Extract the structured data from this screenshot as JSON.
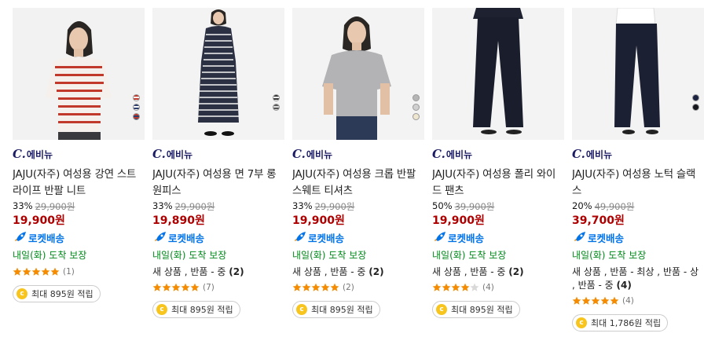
{
  "products": [
    {
      "brand": "에비뉴",
      "title": "JAJU(자주) 여성용 강연 스트라이프 반팔 니트",
      "discount": "33%",
      "original_price": "29,900원",
      "price": "19,900원",
      "rocket_label": "로켓배송",
      "delivery": "내일(화) 도착 보장",
      "condition_text": "",
      "condition_count": "",
      "rating": 5,
      "review_count": "(1)",
      "cashback": "최대 895원 적립",
      "swatches": [
        "#c0392b",
        "#2c3e6e",
        "#ffffff"
      ]
    },
    {
      "brand": "에비뉴",
      "title": "JAJU(자주) 여성용 면 7부 롱 원피스",
      "discount": "33%",
      "original_price": "29,900원",
      "price": "19,890원",
      "rocket_label": "로켓배송",
      "delivery": "내일(화) 도착 보장",
      "condition_text": "새 상품 , 반품 - 중",
      "condition_count": "(2)",
      "rating": 5,
      "review_count": "(7)",
      "cashback": "최대 895원 적립",
      "swatches": [
        "#333333",
        "#ffffff"
      ]
    },
    {
      "brand": "에비뉴",
      "title": "JAJU(자주) 여성용 크롭 반팔 스웨트 티셔츠",
      "discount": "33%",
      "original_price": "29,900원",
      "price": "19,900원",
      "rocket_label": "로켓배송",
      "delivery": "내일(화) 도착 보장",
      "condition_text": "새 상품 , 반품 - 중",
      "condition_count": "(2)",
      "rating": 5,
      "review_count": "(2)",
      "cashback": "최대 895원 적립",
      "swatches": [
        "#b5b5b5",
        "#c8c8c8",
        "#efe6cf"
      ]
    },
    {
      "brand": "에비뉴",
      "title": "JAJU(자주) 여성용 폴리 와이드 팬츠",
      "discount": "50%",
      "original_price": "39,900원",
      "price": "19,900원",
      "rocket_label": "로켓배송",
      "delivery": "내일(화) 도착 보장",
      "condition_text": "새 상품 , 반품 - 중",
      "condition_count": "(2)",
      "rating": 4,
      "review_count": "(4)",
      "cashback": "최대 895원 적립",
      "swatches": []
    },
    {
      "brand": "에비뉴",
      "title": "JAJU(자주) 여성용 노턱 슬랙스",
      "discount": "20%",
      "original_price": "49,900원",
      "price": "39,700원",
      "rocket_label": "로켓배송",
      "delivery": "내일(화) 도착 보장",
      "condition_text": "새 상품 , 반품 - 최상 , 반품 - 상 , 반품 - 중",
      "condition_count": "(4)",
      "rating": 5,
      "review_count": "(4)",
      "cashback": "최대 1,786원 적립",
      "swatches": [
        "#1b2340",
        "#14161c"
      ]
    }
  ],
  "colors": {
    "price_red": "#ae0000",
    "rocket_blue": "#0073e9",
    "delivery_green": "#00891a",
    "star_orange": "#f58b00",
    "brand_navy": "#1c1c64"
  }
}
